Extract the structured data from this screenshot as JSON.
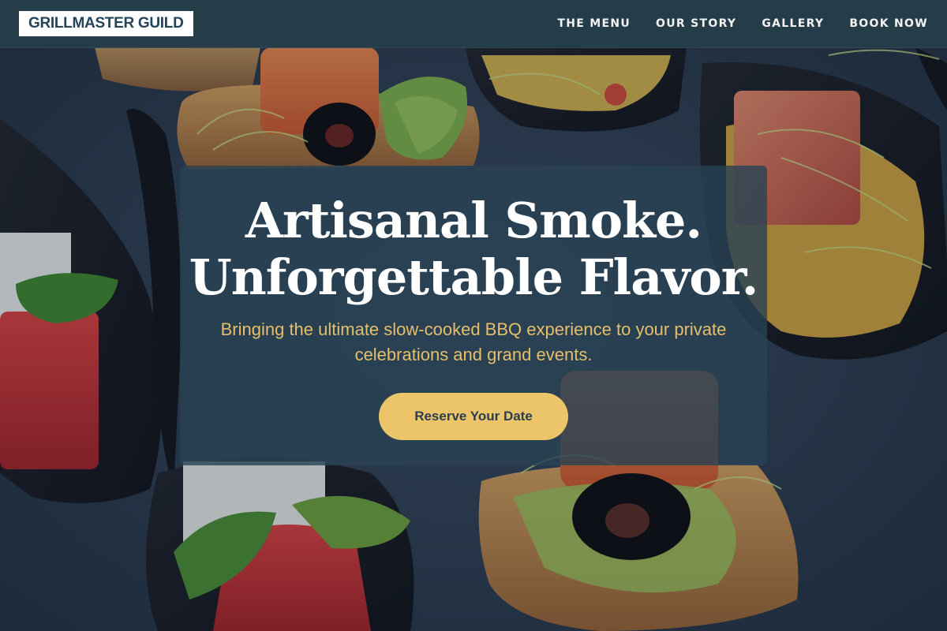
{
  "brand": {
    "logo_text": "GRILLMASTER GUILD"
  },
  "nav": {
    "items": [
      {
        "label": "THE MENU"
      },
      {
        "label": "OUR STORY"
      },
      {
        "label": "GALLERY"
      },
      {
        "label": "BOOK NOW"
      }
    ]
  },
  "hero": {
    "headline_line1": "Artisanal Smoke.",
    "headline_line2": "Unforgettable Flavor.",
    "subtitle": "Bringing the ultimate slow-cooked BBQ experience to your private celebrations and grand events.",
    "cta_label": "Reserve Your Date"
  },
  "colors": {
    "accent": "#ecc56a",
    "subtitle": "#e6bf6b",
    "navbar": "#263e4a",
    "logo_text": "#24445a",
    "background_slate": "#27394d"
  },
  "background": {
    "subject": "canapes-on-slate-photo"
  }
}
